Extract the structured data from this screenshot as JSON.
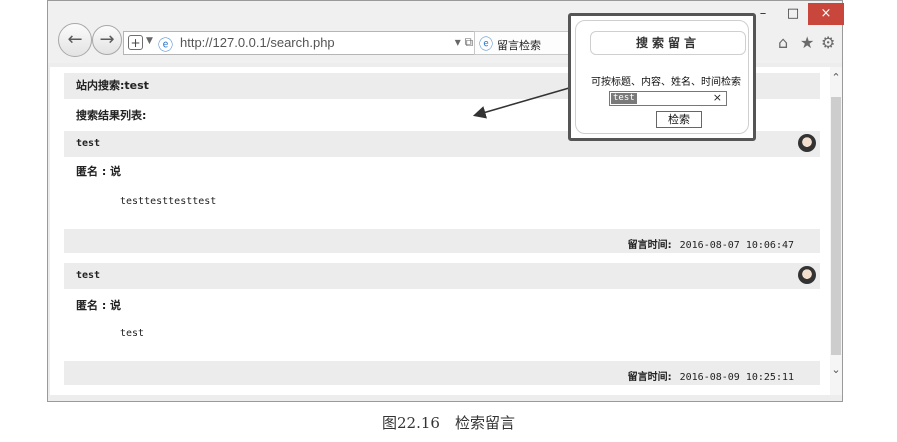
{
  "browser": {
    "url": "http://127.0.0.1/search.php",
    "tab_title": "留言检索",
    "minimize_glyph": "–",
    "maximize_glyph": "□",
    "close_glyph": "×"
  },
  "page": {
    "search_header": "站内搜索:test",
    "results_label": "搜索结果列表:",
    "results": [
      {
        "title": "test",
        "author": "匿名 : 说",
        "body": "testtesttesttest",
        "time_label": "留言时间:",
        "time": "2016-08-07 10:06:47"
      },
      {
        "title": "test",
        "author": "匿名 : 说",
        "body": "test",
        "time_label": "留言时间:",
        "time": "2016-08-09 10:25:11"
      }
    ]
  },
  "popup": {
    "title": "搜索留言",
    "hint": "可按标题、内容、姓名、时间检索",
    "input_value": "test",
    "clear_glyph": "×",
    "button_label": "检索"
  },
  "caption": "图22.16　检索留言",
  "icons": {
    "back": "back-arrow-icon",
    "forward": "forward-arrow-icon",
    "home": "home-icon",
    "favorites": "star-icon",
    "settings": "gear-icon",
    "avatar": "avatar-icon"
  }
}
